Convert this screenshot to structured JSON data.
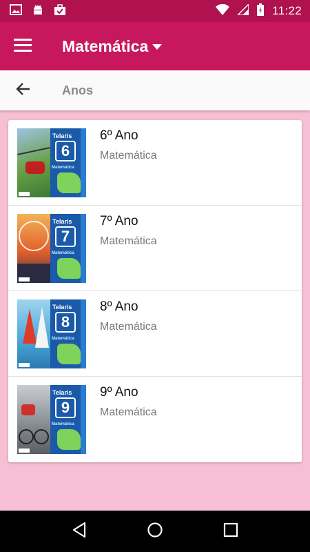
{
  "status_bar": {
    "time": "11:22",
    "left_icons": [
      "image-icon",
      "android-icon",
      "briefcase-icon"
    ],
    "right_icons": [
      "wifi-icon",
      "signal-icon",
      "battery-icon"
    ]
  },
  "app_bar": {
    "title": "Matemática",
    "color": "#c8185d"
  },
  "sub_bar": {
    "title": "Anos"
  },
  "books": [
    {
      "title": "6º Ano",
      "subtitle": "Matemática",
      "cover_brand": "Telaris",
      "cover_number": "6",
      "cover_subject": "Matemática",
      "cover_bg": "#3e7d3a"
    },
    {
      "title": "7º Ano",
      "subtitle": "Matemática",
      "cover_brand": "Telaris",
      "cover_number": "7",
      "cover_subject": "Matemática",
      "cover_bg": "#e07a3a"
    },
    {
      "title": "8º Ano",
      "subtitle": "Matemática",
      "cover_brand": "Telaris",
      "cover_number": "8",
      "cover_subject": "Matemática",
      "cover_bg": "#4aa6d6"
    },
    {
      "title": "9º Ano",
      "subtitle": "Matemática",
      "cover_brand": "Telaris",
      "cover_number": "9",
      "cover_subject": "Matemática",
      "cover_bg": "#8a8f96"
    }
  ],
  "nav_bar": {
    "buttons": [
      "back-triangle-icon",
      "home-circle-icon",
      "recents-square-icon"
    ]
  }
}
